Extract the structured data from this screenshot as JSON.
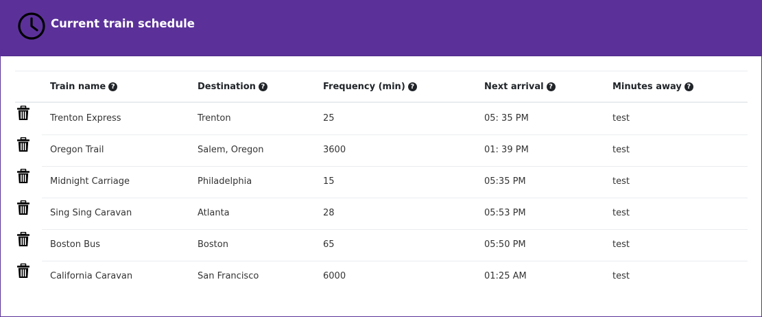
{
  "header": {
    "title": "Current train schedule",
    "icon": "clock-icon",
    "background_color": "#5b3199"
  },
  "table": {
    "columns": [
      {
        "label": "Train name",
        "help_icon": "question-circle-icon"
      },
      {
        "label": "Destination",
        "help_icon": "question-circle-icon"
      },
      {
        "label": "Frequency (min)",
        "help_icon": "question-circle-icon"
      },
      {
        "label": "Next arrival",
        "help_icon": "question-circle-icon"
      },
      {
        "label": "Minutes away",
        "help_icon": "question-circle-icon"
      }
    ],
    "delete_icon": "trash-icon",
    "rows": [
      {
        "train": "Trenton Express",
        "destination": "Trenton",
        "frequency": "25",
        "next_arrival": "05: 35 PM",
        "minutes_away": "test"
      },
      {
        "train": "Oregon Trail",
        "destination": "Salem, Oregon",
        "frequency": "3600",
        "next_arrival": "01: 39 PM",
        "minutes_away": "test"
      },
      {
        "train": "Midnight Carriage",
        "destination": "Philadelphia",
        "frequency": "15",
        "next_arrival": "05:35 PM",
        "minutes_away": "test"
      },
      {
        "train": "Sing Sing Caravan",
        "destination": "Atlanta",
        "frequency": "28",
        "next_arrival": "05:53 PM",
        "minutes_away": "test"
      },
      {
        "train": "Boston Bus",
        "destination": "Boston",
        "frequency": "65",
        "next_arrival": "05:50 PM",
        "minutes_away": "test"
      },
      {
        "train": "California Caravan",
        "destination": "San Francisco",
        "frequency": "6000",
        "next_arrival": "01:25 AM",
        "minutes_away": "test"
      }
    ]
  }
}
